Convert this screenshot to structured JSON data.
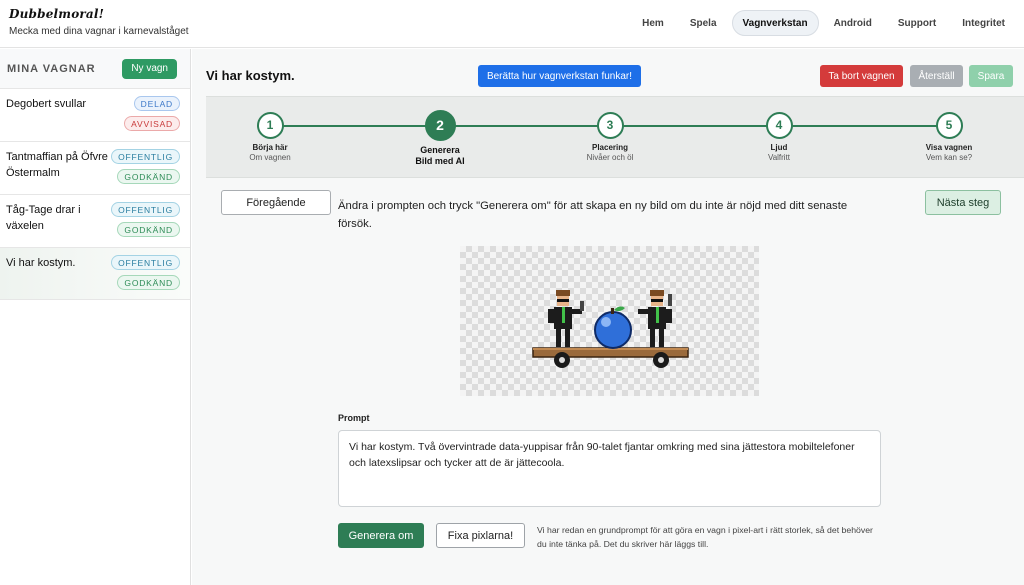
{
  "header": {
    "logo": "Dubbelmoral!",
    "tagline": "Mecka med dina vagnar i karnevalståget",
    "nav": [
      {
        "label": "Hem"
      },
      {
        "label": "Spela"
      },
      {
        "label": "Vagnverkstan",
        "active": true
      },
      {
        "label": "Android"
      },
      {
        "label": "Support"
      },
      {
        "label": "Integritet"
      }
    ]
  },
  "sidebar": {
    "title": "MINA VAGNAR",
    "new_label": "Ny vagn",
    "wagons": [
      {
        "name": "Degobert svullar",
        "badges": [
          "DELAD",
          "AVVISAD"
        ]
      },
      {
        "name": "Tantmaffian på Öfvre Östermalm",
        "badges": [
          "OFFENTLIG",
          "GODKÄND"
        ]
      },
      {
        "name": "Tåg-Tage drar i växelen",
        "badges": [
          "OFFENTLIG",
          "GODKÄND"
        ]
      },
      {
        "name": "Vi har kostym.",
        "badges": [
          "OFFENTLIG",
          "GODKÄND"
        ],
        "active": true
      }
    ]
  },
  "main": {
    "title": "Vi har kostym.",
    "help_label": "Berätta hur vagnverkstan funkar!",
    "delete_label": "Ta bort vagnen",
    "reset_label": "Återställ",
    "save_label": "Spara",
    "steps": [
      {
        "num": "1",
        "title": "Börja här",
        "sub": "Om vagnen"
      },
      {
        "num": "2",
        "title": "Generera",
        "sub": "Bild med AI",
        "active": true
      },
      {
        "num": "3",
        "title": "Placering",
        "sub": "Nivåer och öl"
      },
      {
        "num": "4",
        "title": "Ljud",
        "sub": "Valfritt"
      },
      {
        "num": "5",
        "title": "Visa vagnen",
        "sub": "Vem kan se?"
      }
    ],
    "prev_label": "Föregående",
    "next_label": "Nästa steg",
    "instruction": "Ändra i prompten och tryck \"Generera om\" för att skapa en ny bild om du inte är nöjd med ditt senaste försök.",
    "prompt_label": "Prompt",
    "prompt_value": "Vi har kostym. Två övervintrade data-yuppisar från 90-talet fjantar omkring med sina jättestora mobiltelefoner och latexslipsar och tycker att de är jättecoola.",
    "regen_label": "Generera om",
    "fix_label": "Fixa pixlarna!",
    "hint": "Vi har redan en grundprompt för att göra en vagn i pixel-art i rätt storlek, så det behöver du inte tänka på. Det du skriver här läggs till."
  },
  "colors": {
    "accent_green": "#2e7d55",
    "primary_blue": "#1e6fe8",
    "danger_red": "#d43b3b"
  }
}
